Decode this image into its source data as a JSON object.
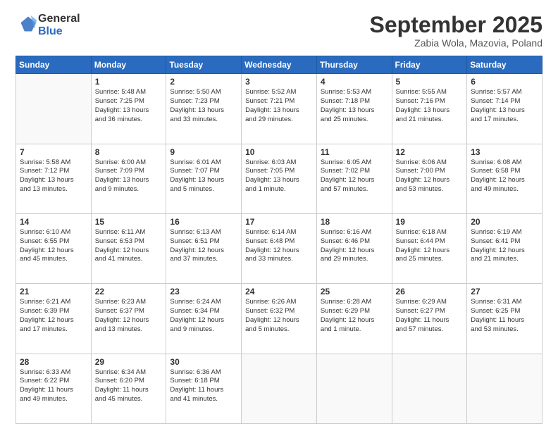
{
  "logo": {
    "general": "General",
    "blue": "Blue"
  },
  "header": {
    "month": "September 2025",
    "location": "Zabia Wola, Mazovia, Poland"
  },
  "days_of_week": [
    "Sunday",
    "Monday",
    "Tuesday",
    "Wednesday",
    "Thursday",
    "Friday",
    "Saturday"
  ],
  "weeks": [
    [
      {
        "day": "",
        "info": ""
      },
      {
        "day": "1",
        "info": "Sunrise: 5:48 AM\nSunset: 7:25 PM\nDaylight: 13 hours\nand 36 minutes."
      },
      {
        "day": "2",
        "info": "Sunrise: 5:50 AM\nSunset: 7:23 PM\nDaylight: 13 hours\nand 33 minutes."
      },
      {
        "day": "3",
        "info": "Sunrise: 5:52 AM\nSunset: 7:21 PM\nDaylight: 13 hours\nand 29 minutes."
      },
      {
        "day": "4",
        "info": "Sunrise: 5:53 AM\nSunset: 7:18 PM\nDaylight: 13 hours\nand 25 minutes."
      },
      {
        "day": "5",
        "info": "Sunrise: 5:55 AM\nSunset: 7:16 PM\nDaylight: 13 hours\nand 21 minutes."
      },
      {
        "day": "6",
        "info": "Sunrise: 5:57 AM\nSunset: 7:14 PM\nDaylight: 13 hours\nand 17 minutes."
      }
    ],
    [
      {
        "day": "7",
        "info": "Sunrise: 5:58 AM\nSunset: 7:12 PM\nDaylight: 13 hours\nand 13 minutes."
      },
      {
        "day": "8",
        "info": "Sunrise: 6:00 AM\nSunset: 7:09 PM\nDaylight: 13 hours\nand 9 minutes."
      },
      {
        "day": "9",
        "info": "Sunrise: 6:01 AM\nSunset: 7:07 PM\nDaylight: 13 hours\nand 5 minutes."
      },
      {
        "day": "10",
        "info": "Sunrise: 6:03 AM\nSunset: 7:05 PM\nDaylight: 13 hours\nand 1 minute."
      },
      {
        "day": "11",
        "info": "Sunrise: 6:05 AM\nSunset: 7:02 PM\nDaylight: 12 hours\nand 57 minutes."
      },
      {
        "day": "12",
        "info": "Sunrise: 6:06 AM\nSunset: 7:00 PM\nDaylight: 12 hours\nand 53 minutes."
      },
      {
        "day": "13",
        "info": "Sunrise: 6:08 AM\nSunset: 6:58 PM\nDaylight: 12 hours\nand 49 minutes."
      }
    ],
    [
      {
        "day": "14",
        "info": "Sunrise: 6:10 AM\nSunset: 6:55 PM\nDaylight: 12 hours\nand 45 minutes."
      },
      {
        "day": "15",
        "info": "Sunrise: 6:11 AM\nSunset: 6:53 PM\nDaylight: 12 hours\nand 41 minutes."
      },
      {
        "day": "16",
        "info": "Sunrise: 6:13 AM\nSunset: 6:51 PM\nDaylight: 12 hours\nand 37 minutes."
      },
      {
        "day": "17",
        "info": "Sunrise: 6:14 AM\nSunset: 6:48 PM\nDaylight: 12 hours\nand 33 minutes."
      },
      {
        "day": "18",
        "info": "Sunrise: 6:16 AM\nSunset: 6:46 PM\nDaylight: 12 hours\nand 29 minutes."
      },
      {
        "day": "19",
        "info": "Sunrise: 6:18 AM\nSunset: 6:44 PM\nDaylight: 12 hours\nand 25 minutes."
      },
      {
        "day": "20",
        "info": "Sunrise: 6:19 AM\nSunset: 6:41 PM\nDaylight: 12 hours\nand 21 minutes."
      }
    ],
    [
      {
        "day": "21",
        "info": "Sunrise: 6:21 AM\nSunset: 6:39 PM\nDaylight: 12 hours\nand 17 minutes."
      },
      {
        "day": "22",
        "info": "Sunrise: 6:23 AM\nSunset: 6:37 PM\nDaylight: 12 hours\nand 13 minutes."
      },
      {
        "day": "23",
        "info": "Sunrise: 6:24 AM\nSunset: 6:34 PM\nDaylight: 12 hours\nand 9 minutes."
      },
      {
        "day": "24",
        "info": "Sunrise: 6:26 AM\nSunset: 6:32 PM\nDaylight: 12 hours\nand 5 minutes."
      },
      {
        "day": "25",
        "info": "Sunrise: 6:28 AM\nSunset: 6:29 PM\nDaylight: 12 hours\nand 1 minute."
      },
      {
        "day": "26",
        "info": "Sunrise: 6:29 AM\nSunset: 6:27 PM\nDaylight: 11 hours\nand 57 minutes."
      },
      {
        "day": "27",
        "info": "Sunrise: 6:31 AM\nSunset: 6:25 PM\nDaylight: 11 hours\nand 53 minutes."
      }
    ],
    [
      {
        "day": "28",
        "info": "Sunrise: 6:33 AM\nSunset: 6:22 PM\nDaylight: 11 hours\nand 49 minutes."
      },
      {
        "day": "29",
        "info": "Sunrise: 6:34 AM\nSunset: 6:20 PM\nDaylight: 11 hours\nand 45 minutes."
      },
      {
        "day": "30",
        "info": "Sunrise: 6:36 AM\nSunset: 6:18 PM\nDaylight: 11 hours\nand 41 minutes."
      },
      {
        "day": "",
        "info": ""
      },
      {
        "day": "",
        "info": ""
      },
      {
        "day": "",
        "info": ""
      },
      {
        "day": "",
        "info": ""
      }
    ]
  ]
}
